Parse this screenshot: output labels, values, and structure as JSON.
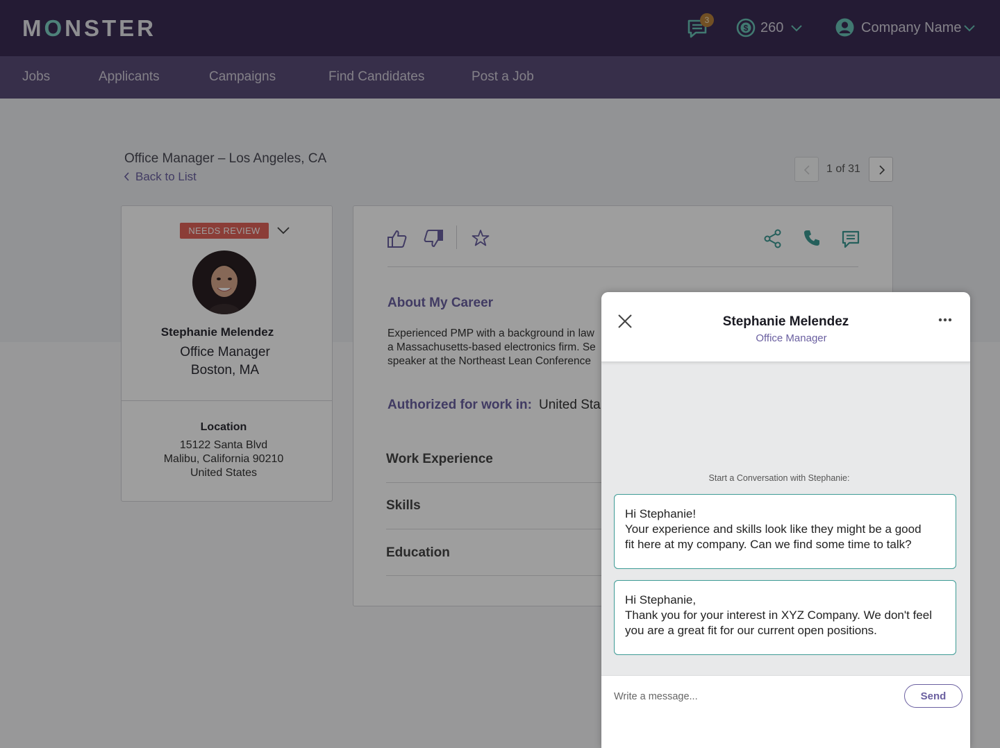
{
  "header": {
    "logo": [
      "M",
      "O",
      "NSTER"
    ],
    "notification_count": "3",
    "coins": "260",
    "company": "Company Name"
  },
  "nav": {
    "items": [
      "Jobs",
      "Applicants",
      "Campaigns",
      "Find Candidates",
      "Post a Job"
    ]
  },
  "job": {
    "title": "Office Manager – Los Angeles, CA",
    "back": "Back to List",
    "pager": "1 of 31"
  },
  "candidate": {
    "status": "NEEDS REVIEW",
    "name": "Stephanie Melendez",
    "title": "Office Manager",
    "location": "Boston, MA",
    "address_label": "Location",
    "address": [
      "15122 Santa Blvd",
      "Malibu, California 90210",
      "United States"
    ]
  },
  "profile": {
    "about_title": "About My Career",
    "about_lines": [
      "Experienced PMP with a background in law",
      "a Massachusetts-based electronics firm. Se",
      "speaker at the Northeast Lean Conference"
    ],
    "authorized_label": "Authorized for work in:",
    "authorized_value": "United Sta",
    "sections": [
      "Work Experience",
      "Skills",
      "Education"
    ]
  },
  "chat": {
    "name": "Stephanie Melendez",
    "role": "Office Manager",
    "hint": "Start a Conversation with Stephanie:",
    "suggestions": [
      [
        "Hi Stephanie!",
        "Your experience and skills look like they might be a good",
        "fit here at my company.  Can we find some time to talk?"
      ],
      [
        "Hi Stephanie,",
        "Thank you for your interest in XYZ Company.  We don't feel",
        "you are a great fit for our current open positions."
      ]
    ],
    "input_placeholder": "Write a message...",
    "send": "Send"
  },
  "colors": {
    "header": "#3a2d55",
    "nav": "#5a4d78",
    "accent": "#6a5fa0",
    "teal": "#3c9a94",
    "status": "#e0635a"
  },
  "icons": [
    "message-icon",
    "coin-icon",
    "user-icon",
    "chevron-down-icon",
    "chevron-left-icon",
    "chevron-right-icon",
    "thumbs-up-icon",
    "thumbs-down-icon",
    "star-icon",
    "share-icon",
    "phone-icon",
    "chat-icon",
    "close-icon",
    "more-icon"
  ]
}
